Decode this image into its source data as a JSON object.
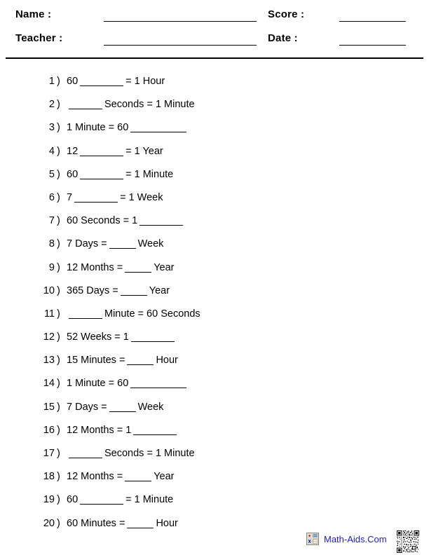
{
  "header": {
    "name_label": "Name :",
    "teacher_label": "Teacher :",
    "score_label": "Score :",
    "date_label": "Date :",
    "name_value": "",
    "teacher_value": "",
    "score_value": "",
    "date_value": ""
  },
  "questions": [
    {
      "number": "1",
      "paren": ")",
      "parts": [
        {
          "t": "text",
          "v": "60"
        },
        {
          "t": "blank",
          "size": "long"
        },
        {
          "t": "text",
          "v": "= 1 Hour"
        }
      ]
    },
    {
      "number": "2",
      "paren": ")",
      "parts": [
        {
          "t": "blank",
          "size": "mid"
        },
        {
          "t": "text",
          "v": "Seconds = 1 Minute"
        }
      ]
    },
    {
      "number": "3",
      "paren": ")",
      "parts": [
        {
          "t": "text",
          "v": "1 Minute = 60"
        },
        {
          "t": "blank",
          "size": "xlong"
        }
      ]
    },
    {
      "number": "4",
      "paren": ")",
      "parts": [
        {
          "t": "text",
          "v": "12"
        },
        {
          "t": "blank",
          "size": "long"
        },
        {
          "t": "text",
          "v": "= 1 Year"
        }
      ]
    },
    {
      "number": "5",
      "paren": ")",
      "parts": [
        {
          "t": "text",
          "v": "60"
        },
        {
          "t": "blank",
          "size": "long"
        },
        {
          "t": "text",
          "v": "= 1 Minute"
        }
      ]
    },
    {
      "number": "6",
      "paren": ")",
      "parts": [
        {
          "t": "text",
          "v": "7"
        },
        {
          "t": "blank",
          "size": "long"
        },
        {
          "t": "text",
          "v": "= 1 Week"
        }
      ]
    },
    {
      "number": "7",
      "paren": ")",
      "parts": [
        {
          "t": "text",
          "v": "60 Seconds = 1"
        },
        {
          "t": "blank",
          "size": "long"
        }
      ]
    },
    {
      "number": "8",
      "paren": ")",
      "parts": [
        {
          "t": "text",
          "v": "7 Days ="
        },
        {
          "t": "blank",
          "size": "short"
        },
        {
          "t": "text",
          "v": "Week"
        }
      ]
    },
    {
      "number": "9",
      "paren": ")",
      "parts": [
        {
          "t": "text",
          "v": "12 Months ="
        },
        {
          "t": "blank",
          "size": "short"
        },
        {
          "t": "text",
          "v": "Year"
        }
      ]
    },
    {
      "number": "10",
      "paren": ")",
      "parts": [
        {
          "t": "text",
          "v": "365 Days ="
        },
        {
          "t": "blank",
          "size": "short"
        },
        {
          "t": "text",
          "v": "Year"
        }
      ]
    },
    {
      "number": "11",
      "paren": ")",
      "parts": [
        {
          "t": "blank",
          "size": "mid"
        },
        {
          "t": "text",
          "v": "Minute = 60 Seconds"
        }
      ]
    },
    {
      "number": "12",
      "paren": ")",
      "parts": [
        {
          "t": "text",
          "v": "52 Weeks = 1"
        },
        {
          "t": "blank",
          "size": "long"
        }
      ]
    },
    {
      "number": "13",
      "paren": ")",
      "parts": [
        {
          "t": "text",
          "v": "15 Minutes ="
        },
        {
          "t": "blank",
          "size": "short"
        },
        {
          "t": "text",
          "v": "Hour"
        }
      ]
    },
    {
      "number": "14",
      "paren": ")",
      "parts": [
        {
          "t": "text",
          "v": "1 Minute = 60"
        },
        {
          "t": "blank",
          "size": "xlong"
        }
      ]
    },
    {
      "number": "15",
      "paren": ")",
      "parts": [
        {
          "t": "text",
          "v": "7 Days ="
        },
        {
          "t": "blank",
          "size": "short"
        },
        {
          "t": "text",
          "v": "Week"
        }
      ]
    },
    {
      "number": "16",
      "paren": ")",
      "parts": [
        {
          "t": "text",
          "v": "12 Months = 1"
        },
        {
          "t": "blank",
          "size": "long"
        }
      ]
    },
    {
      "number": "17",
      "paren": ")",
      "parts": [
        {
          "t": "blank",
          "size": "mid"
        },
        {
          "t": "text",
          "v": "Seconds = 1 Minute"
        }
      ]
    },
    {
      "number": "18",
      "paren": ")",
      "parts": [
        {
          "t": "text",
          "v": "12 Months ="
        },
        {
          "t": "blank",
          "size": "short"
        },
        {
          "t": "text",
          "v": "Year"
        }
      ]
    },
    {
      "number": "19",
      "paren": ")",
      "parts": [
        {
          "t": "text",
          "v": "60"
        },
        {
          "t": "blank",
          "size": "long"
        },
        {
          "t": "text",
          "v": "= 1 Minute"
        }
      ]
    },
    {
      "number": "20",
      "paren": ")",
      "parts": [
        {
          "t": "text",
          "v": "60 Minutes ="
        },
        {
          "t": "blank",
          "size": "short"
        },
        {
          "t": "text",
          "v": "Hour"
        }
      ]
    }
  ],
  "footer": {
    "brand_text": "Math-Aids.Com",
    "brand_color": "#2222bb",
    "calculator_icon": "calculator-icon",
    "qr_icon": "qr-code-icon"
  }
}
